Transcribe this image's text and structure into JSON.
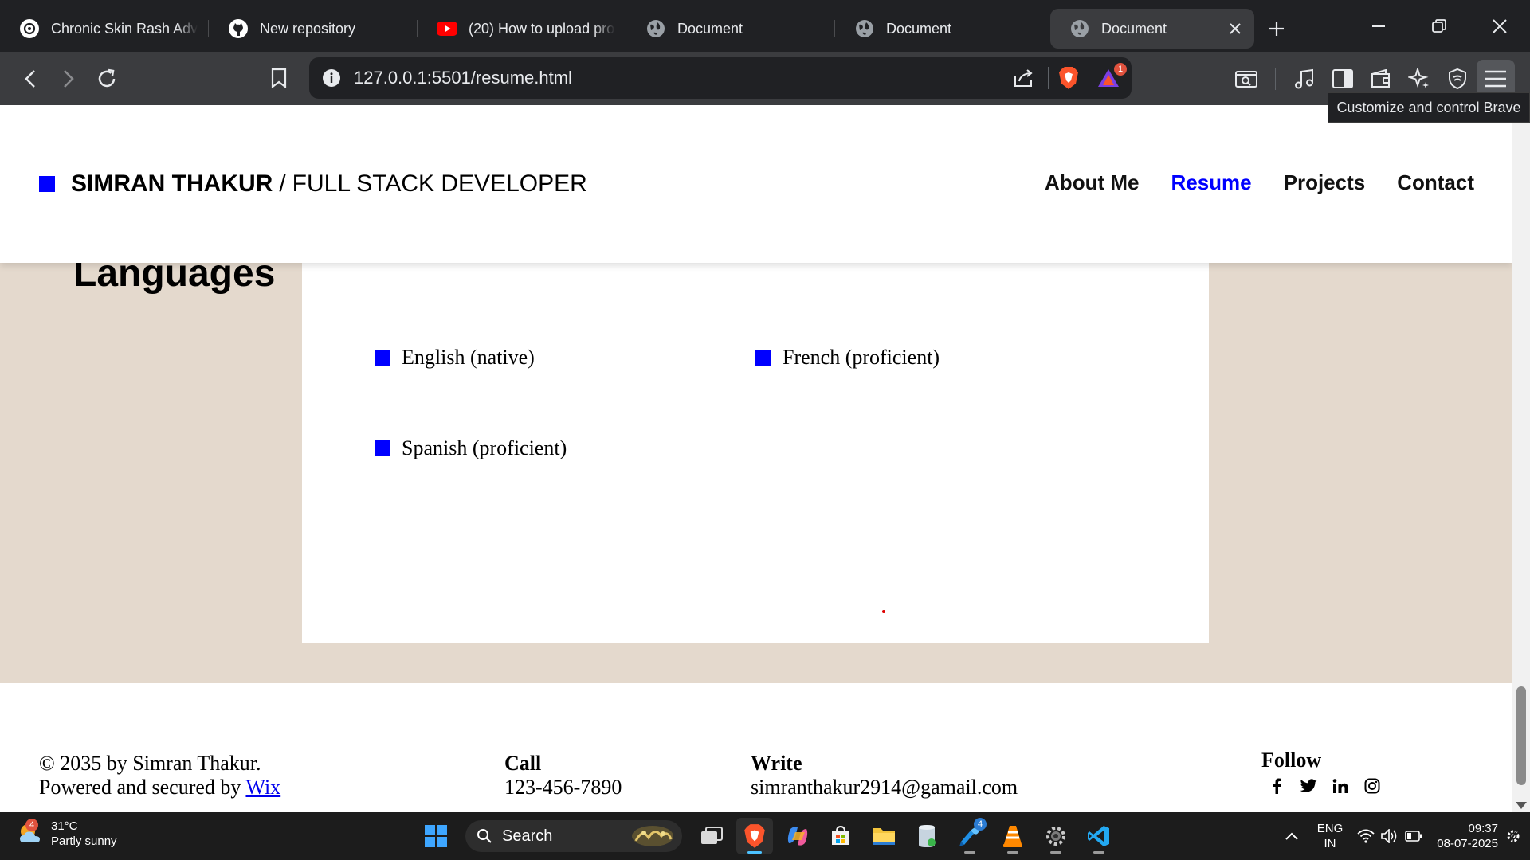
{
  "browser": {
    "tabs": [
      {
        "title": "Chronic Skin Rash Advi",
        "icon": "chatgpt-icon"
      },
      {
        "title": "New repository",
        "icon": "github-icon"
      },
      {
        "title": "(20) How to upload pro",
        "icon": "youtube-icon"
      },
      {
        "title": "Document",
        "icon": "globe-icon"
      },
      {
        "title": "Document",
        "icon": "globe-icon"
      },
      {
        "title": "Document",
        "icon": "globe-icon",
        "active": true
      }
    ],
    "url": "127.0.0.1:5501/resume.html",
    "shields_badge": "1",
    "tooltip": "Customize and control Brave"
  },
  "site": {
    "brand_name": "SIMRAN THAKUR",
    "brand_sep": "/",
    "brand_role": "FULL STACK DEVELOPER",
    "nav": [
      "About Me",
      "Resume",
      "Projects",
      "Contact"
    ],
    "nav_active": "Resume",
    "accent": "#0000ff",
    "background": "#e4d9cd"
  },
  "languages": {
    "heading": "Languages",
    "items": [
      "English (native)",
      "French (proficient)",
      "Spanish (proficient)"
    ]
  },
  "footer": {
    "copyright": "© 2035 by Simran Thakur.",
    "powered_prefix": "Powered and secured by",
    "powered_link": "Wix",
    "call_heading": "Call",
    "call_value": "123-456-7890",
    "write_heading": "Write",
    "write_value": "simranthakur2914@gamail.com",
    "follow_heading": "Follow",
    "socials": [
      "facebook-icon",
      "twitter-icon",
      "linkedin-icon",
      "instagram-icon"
    ]
  },
  "taskbar": {
    "weather_temp": "31°C",
    "weather_desc": "Partly sunny",
    "weather_badge": "4",
    "search_label": "Search",
    "edge_badge": "4",
    "lang_top": "ENG",
    "lang_bottom": "IN",
    "time": "09:37",
    "date": "08-07-2025"
  }
}
